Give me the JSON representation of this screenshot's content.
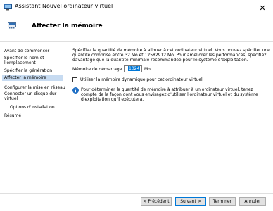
{
  "window": {
    "title": "Assistant Nouvel ordinateur virtuel",
    "close_glyph": "✕"
  },
  "header": {
    "title": "Affecter la mémoire"
  },
  "sidebar": {
    "items": [
      {
        "label": "Avant de commencer"
      },
      {
        "label": "Spécifier le nom et"
      },
      {
        "label": "l'emplacement"
      },
      {
        "label": "Spécifier la génération"
      },
      {
        "label": "Affecter la mémoire",
        "active": true
      },
      {
        "label": "Configurer la mise en réseau"
      },
      {
        "label": "Connecter un disque dur"
      },
      {
        "label": "virtuel"
      },
      {
        "label": "Options d'installation"
      },
      {
        "label": "Résumé"
      }
    ]
  },
  "content": {
    "description": "Spécifiez la quantité de mémoire à allouer à cet ordinateur virtuel. Vous pouvez spécifier une quantité comprise entre 32 Mo et 12582912 Mo. Pour améliorer les performances, spécifiez davantage que la quantité minimale recommandée pour le système d'exploitation.",
    "startup_memory": {
      "label": "Mémoire de démarrage :",
      "value": "1024",
      "unit": "Mo"
    },
    "dynamic_memory": {
      "label": "Utiliser la mémoire dynamique pour cet ordinateur virtuel.",
      "checked": false
    },
    "info": "Pour déterminer la quantité de mémoire à attribuer à un ordinateur virtuel, tenez compte de la façon dont vous envisagez d'utiliser l'ordinateur virtuel et du système d'exploitation qu'il exécutera."
  },
  "footer": {
    "previous": "< Précédent",
    "next": "Suivant >",
    "finish": "Terminer",
    "cancel": "Annuler"
  },
  "colors": {
    "selection": "#c7dbf1",
    "accent": "#0078d7",
    "info_icon": "#1f6fc5"
  }
}
